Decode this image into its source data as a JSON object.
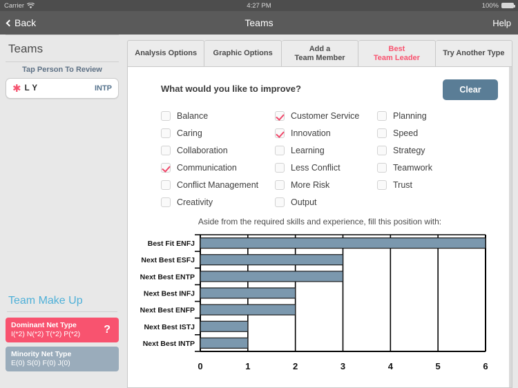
{
  "status_bar": {
    "carrier": "Carrier",
    "wifi_icon": "wifi-icon",
    "time": "4:27 PM",
    "battery_percent": "100%",
    "battery_icon": "battery-full-icon"
  },
  "nav_bar": {
    "back_label": "Back",
    "back_icon": "chevron-left-icon",
    "title": "Teams",
    "help_label": "Help"
  },
  "sidebar": {
    "title": "Teams",
    "subtitle": "Tap Person To Review",
    "person": {
      "star_icon": "asterisk-icon",
      "name": "L Y",
      "type": "INTP"
    },
    "team_make_up": {
      "title": "Team Make Up",
      "badges": [
        {
          "label": "Dominant Net Type",
          "values": "I(*2) N(*2) T(*2) P(*2)",
          "help_glyph": "?",
          "color": "#f8536f"
        },
        {
          "label": "Minority Net Type",
          "values": "E(0) S(0) F(0) J(0)",
          "help_glyph": "",
          "color": "#9aacbb"
        }
      ]
    }
  },
  "tabs": [
    {
      "label": "Analysis Options",
      "active": false
    },
    {
      "label": "Graphic Options",
      "active": false
    },
    {
      "label": "Add a\nTeam Member",
      "line1": "Add a",
      "line2": "Team Member",
      "active": false
    },
    {
      "label": "Best\nTeam Leader",
      "line1": "Best",
      "line2": "Team Leader",
      "active": true
    },
    {
      "label": "Try Another Type",
      "active": false
    }
  ],
  "panel": {
    "question": "What would you like to improve?",
    "clear_label": "Clear",
    "clear_color": "#5a7d96",
    "checkboxes": [
      {
        "label": "Balance",
        "checked": false
      },
      {
        "label": "Customer Service",
        "checked": true
      },
      {
        "label": "Planning",
        "checked": false
      },
      {
        "label": "Caring",
        "checked": false
      },
      {
        "label": "Innovation",
        "checked": true
      },
      {
        "label": "Speed",
        "checked": false
      },
      {
        "label": "Collaboration",
        "checked": false
      },
      {
        "label": "Learning",
        "checked": false
      },
      {
        "label": "Strategy",
        "checked": false
      },
      {
        "label": "Communication",
        "checked": true
      },
      {
        "label": "Less Conflict",
        "checked": false
      },
      {
        "label": "Teamwork",
        "checked": false
      },
      {
        "label": "Conflict Management",
        "checked": false
      },
      {
        "label": "More Risk",
        "checked": false
      },
      {
        "label": "Trust",
        "checked": false
      },
      {
        "label": "Creativity",
        "checked": false
      },
      {
        "label": "Output",
        "checked": false
      },
      {
        "label": "",
        "checked": false
      }
    ],
    "chart_caption": "Aside from the required skills and experience, fill this position with:"
  },
  "chart_data": {
    "type": "bar",
    "orientation": "horizontal",
    "title": "Aside from the required skills and experience, fill this position with:",
    "categories": [
      "Best Fit ENFJ",
      "Next Best ESFJ",
      "Next Best ENTP",
      "Next Best INFJ",
      "Next Best ENFP",
      "Next Best ISTJ",
      "Next Best INTP"
    ],
    "values": [
      6,
      3,
      3,
      2,
      2,
      1,
      1
    ],
    "xlabel": "",
    "ylabel": "",
    "xlim": [
      0,
      6
    ],
    "xticks": [
      "0",
      "1",
      "2",
      "3",
      "4",
      "5",
      "6"
    ],
    "grid": true,
    "bar_color": "#7b98ae",
    "bar_edge_color": "#1a1a1a",
    "legend": null
  }
}
